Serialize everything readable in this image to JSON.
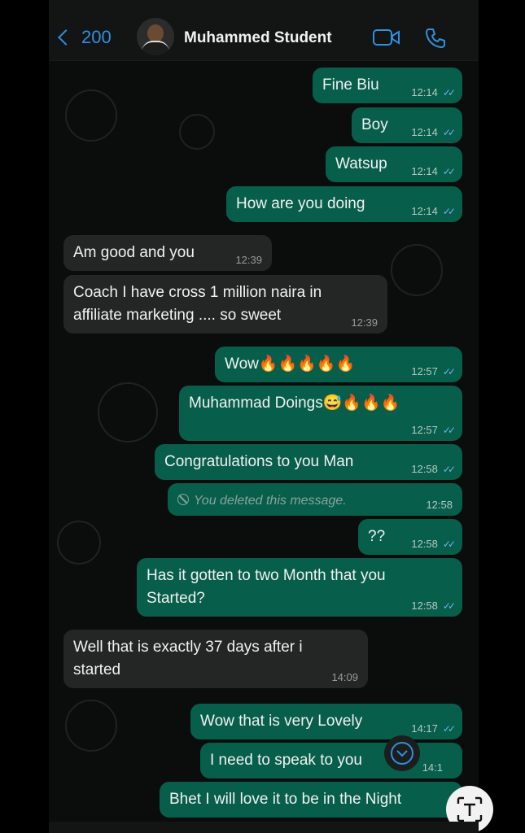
{
  "header": {
    "back_count": "200",
    "contact_name": "Muhammed Student",
    "video_icon": "video-call-icon",
    "phone_icon": "phone-call-icon"
  },
  "messages": [
    {
      "dir": "out",
      "text": "Fine Biu",
      "time": "12:14",
      "ticks": "✓✓"
    },
    {
      "dir": "out",
      "text": "Boy",
      "time": "12:14",
      "ticks": "✓✓"
    },
    {
      "dir": "out",
      "text": "Watsup",
      "time": "12:14",
      "ticks": "✓✓"
    },
    {
      "dir": "out",
      "text": "How are you doing",
      "time": "12:14",
      "ticks": "✓✓"
    },
    {
      "dir": "in",
      "text": "Am good and you",
      "time": "12:39"
    },
    {
      "dir": "in",
      "text": "Coach I have cross 1 million naira in affiliate marketing .... so sweet",
      "time": "12:39"
    },
    {
      "dir": "out",
      "text": "Wow🔥🔥🔥🔥🔥",
      "time": "12:57",
      "ticks": "✓✓"
    },
    {
      "dir": "out",
      "text": "Muhammad Doings😅🔥🔥🔥",
      "time": "12:57",
      "ticks": "✓✓"
    },
    {
      "dir": "out",
      "text": "Congratulations to you Man",
      "time": "12:58",
      "ticks": "✓✓"
    },
    {
      "dir": "out",
      "text": "You deleted this message.",
      "time": "12:58",
      "deleted": true
    },
    {
      "dir": "out",
      "text": "??",
      "time": "12:58",
      "ticks": "✓✓"
    },
    {
      "dir": "out",
      "text": "Has it gotten to two Month that you Started?",
      "time": "12:58",
      "ticks": "✓✓"
    },
    {
      "dir": "in",
      "text": "Well that is exactly 37 days after i started",
      "time": "14:09"
    },
    {
      "dir": "out",
      "text": "Wow that is very Lovely",
      "time": "14:17",
      "ticks": "✓✓"
    },
    {
      "dir": "out",
      "text": "I need to speak to you",
      "time": "14:1"
    },
    {
      "dir": "out",
      "text": "Bhet I will love it to be in the Night",
      "time": ""
    }
  ],
  "overlay": {
    "scroll_icon": "chevron-down-icon",
    "lens_icon": "text-scan-icon"
  },
  "colors": {
    "outgoing": "#075e4b",
    "incoming": "#232624",
    "accent": "#2f8fe0",
    "ticks": "#6fb3f2"
  }
}
